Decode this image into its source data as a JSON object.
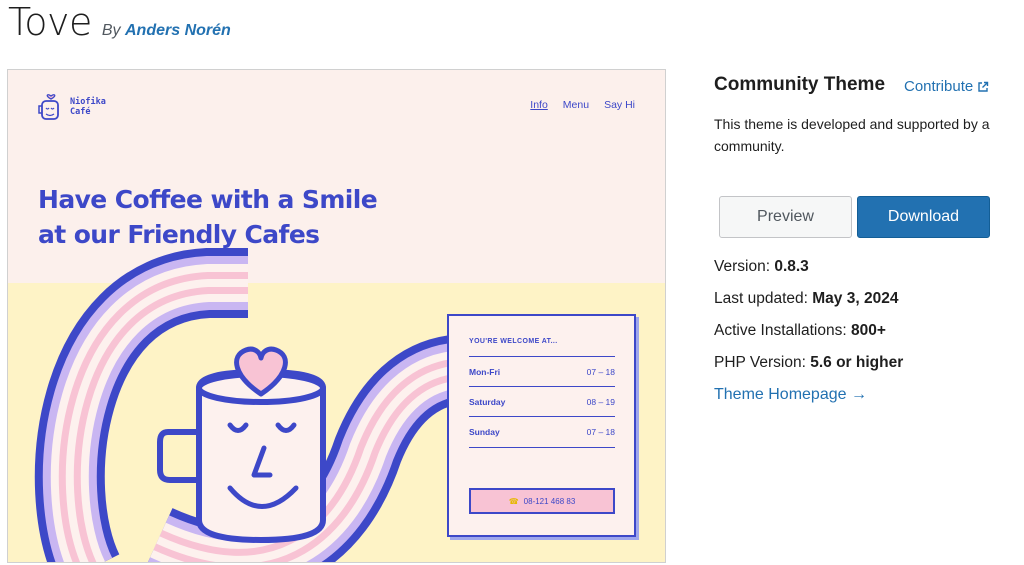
{
  "header": {
    "theme_name": "Tove",
    "by_label": "By",
    "author": "Anders Norén"
  },
  "screenshot": {
    "logo_line1": "Niofika",
    "logo_line2": "Café",
    "nav": [
      "Info",
      "Menu",
      "Say Hi"
    ],
    "hero_line1": "Have Coffee with a Smile",
    "hero_line2": "at our Friendly Cafes",
    "hours_heading": "YOU'RE WELCOME AT...",
    "hours": [
      {
        "day": "Mon-Fri",
        "time": "07 – 18"
      },
      {
        "day": "Saturday",
        "time": "08 – 19"
      },
      {
        "day": "Sunday",
        "time": "07 – 18"
      }
    ],
    "phone": "08-121 468 83",
    "colors": {
      "blue": "#3d48c8",
      "pink": "#f8c3d4",
      "lavender": "#c9b6f2",
      "cream": "#fef3c6",
      "blush": "#fcf0ec"
    }
  },
  "sidebar": {
    "community_title": "Community Theme",
    "contribute_label": "Contribute",
    "contribute_icon": "external-link-icon",
    "description": "This theme is developed and supported by a community.",
    "preview_label": "Preview",
    "download_label": "Download",
    "version_label": "Version:",
    "version_value": "0.8.3",
    "updated_label": "Last updated:",
    "updated_value": "May 3, 2024",
    "installs_label": "Active Installations:",
    "installs_value": "800+",
    "php_label": "PHP Version:",
    "php_value": "5.6 or higher",
    "homepage_label": "Theme Homepage →"
  }
}
